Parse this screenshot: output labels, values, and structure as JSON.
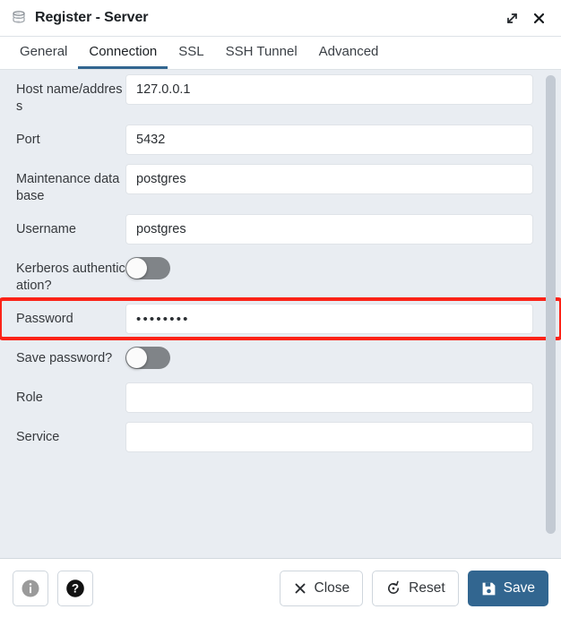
{
  "window": {
    "title": "Register - Server",
    "icon": "server-stack-icon",
    "expand_icon": "expand-diagonal-icon",
    "close_icon": "close-x-icon"
  },
  "tabs": [
    {
      "label": "General",
      "active": false
    },
    {
      "label": "Connection",
      "active": true
    },
    {
      "label": "SSL",
      "active": false
    },
    {
      "label": "SSH Tunnel",
      "active": false
    },
    {
      "label": "Advanced",
      "active": false
    }
  ],
  "form": {
    "fields": [
      {
        "label": "Host name/address",
        "type": "text",
        "value": "127.0.0.1",
        "placeholder": ""
      },
      {
        "label": "Port",
        "type": "text",
        "value": "5432",
        "placeholder": ""
      },
      {
        "label": "Maintenance database",
        "type": "text",
        "value": "postgres",
        "placeholder": ""
      },
      {
        "label": "Username",
        "type": "text",
        "value": "postgres",
        "placeholder": ""
      },
      {
        "label": "Kerberos authentication?",
        "type": "toggle",
        "value": "off"
      },
      {
        "label": "Password",
        "type": "password",
        "value": "••••••••",
        "placeholder": "",
        "highlighted": true
      },
      {
        "label": "Save password?",
        "type": "toggle",
        "value": "off"
      },
      {
        "label": "Role",
        "type": "text",
        "value": "",
        "placeholder": ""
      },
      {
        "label": "Service",
        "type": "text",
        "value": "",
        "placeholder": ""
      }
    ]
  },
  "footer": {
    "info_label": "",
    "info_icon": "info-circle-icon",
    "help_icon": "help-circle-icon",
    "close_label": "Close",
    "close_icon": "close-x-icon",
    "reset_label": "Reset",
    "reset_icon": "reset-circular-arrow-icon",
    "save_label": "Save",
    "save_icon": "floppy-disk-icon"
  },
  "colors": {
    "accent": "#326690",
    "highlight": "#fb2318",
    "body_background": "#e9edf2",
    "toggle_off_track": "#808488"
  }
}
